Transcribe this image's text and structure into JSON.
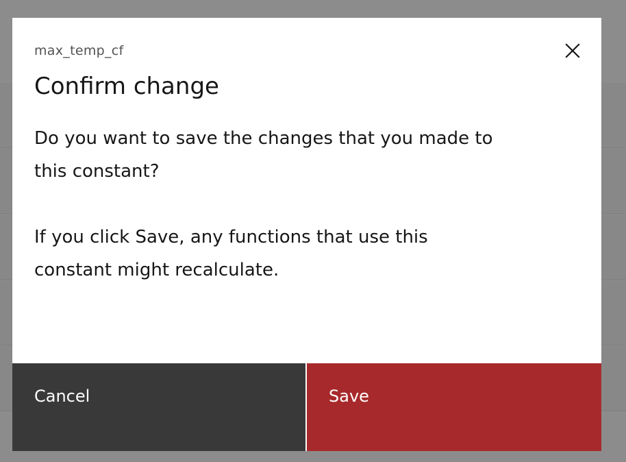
{
  "modal": {
    "label": "max_temp_cf",
    "title": "Confirm change",
    "body": [
      "Do you want to save the changes that you made to\nthis constant?",
      "If you click Save, any functions that use this\nconstant might recalculate."
    ],
    "close_icon": "close-icon",
    "cancel_label": "Cancel",
    "save_label": "Save"
  },
  "colors": {
    "overlay": "#8c8c8c",
    "cancel_bg": "#393939",
    "save_bg": "#a8292b",
    "text": "#161616"
  }
}
